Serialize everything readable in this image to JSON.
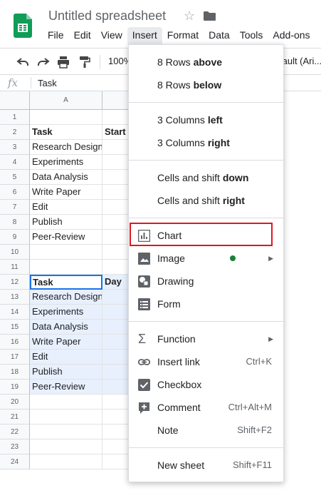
{
  "app": {
    "title": "Untitled spreadsheet",
    "star_icon": "☆",
    "menu": [
      "File",
      "Edit",
      "View",
      "Insert",
      "Format",
      "Data",
      "Tools",
      "Add-ons"
    ],
    "active_menu_index": 3
  },
  "toolbar": {
    "zoom": "100%",
    "font": "fault (Ari..."
  },
  "formula_bar": {
    "fx": "fx",
    "value": "Task"
  },
  "columns": [
    "A"
  ],
  "rows": [
    "1",
    "2",
    "3",
    "4",
    "5",
    "6",
    "7",
    "8",
    "9",
    "10",
    "11",
    "12",
    "13",
    "14",
    "15",
    "16",
    "17",
    "18",
    "19",
    "20",
    "21",
    "22",
    "23",
    "24"
  ],
  "table1": {
    "header_a": "Task",
    "header_b": "Start",
    "tasks": [
      "Research Design",
      "Experiments",
      "Data Analysis",
      "Write Paper",
      "Edit",
      "Publish",
      "Peer-Review"
    ]
  },
  "table2": {
    "header_a": "Task",
    "header_b": "Day",
    "tasks": [
      "Research Design",
      "Experiments",
      "Data Analysis",
      "Write Paper",
      "Edit",
      "Publish",
      "Peer-Review"
    ]
  },
  "insert_menu": {
    "rows_above": {
      "pre": "8 Rows ",
      "bold": "above"
    },
    "rows_below": {
      "pre": "8 Rows ",
      "bold": "below"
    },
    "cols_left": {
      "pre": "3 Columns ",
      "bold": "left"
    },
    "cols_right": {
      "pre": "3 Columns ",
      "bold": "right"
    },
    "shift_down": {
      "pre": "Cells and shift ",
      "bold": "down"
    },
    "shift_right": {
      "pre": "Cells and shift ",
      "bold": "right"
    },
    "chart": "Chart",
    "image": "Image",
    "drawing": "Drawing",
    "form": "Form",
    "function": "Function",
    "insert_link": "Insert link",
    "insert_link_shortcut": "Ctrl+K",
    "checkbox": "Checkbox",
    "comment": "Comment",
    "comment_shortcut": "Ctrl+Alt+M",
    "note": "Note",
    "note_shortcut": "Shift+F2",
    "new_sheet": "New sheet",
    "new_sheet_shortcut": "Shift+F11"
  },
  "colors": {
    "brand_green": "#0f9d58",
    "highlight_red": "#e0161f",
    "selection_blue": "#1a73e8"
  }
}
